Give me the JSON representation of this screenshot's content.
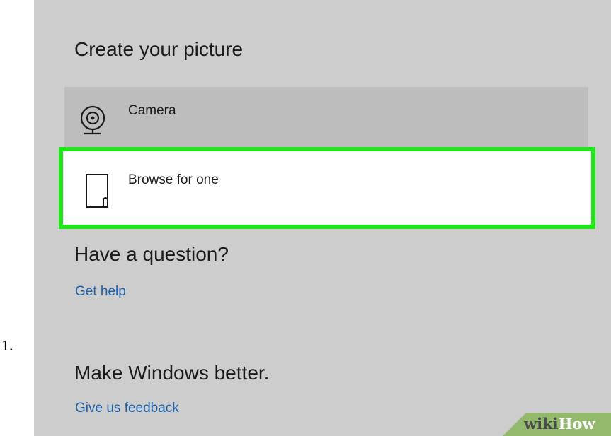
{
  "list_number": "1.",
  "create_section": {
    "title": "Create your picture",
    "options": [
      {
        "label": "Camera",
        "icon": "webcam-icon"
      },
      {
        "label": "Browse for one",
        "icon": "browse-file-icon",
        "highlighted": true,
        "highlight_color": "#22e51b"
      }
    ]
  },
  "question_section": {
    "title": "Have a question?",
    "link": "Get help"
  },
  "feedback_section": {
    "title": "Make Windows better.",
    "link": "Give us feedback"
  },
  "watermark": {
    "wiki": "wiki",
    "how": "How",
    "color": "#93b96d"
  },
  "colors": {
    "panel_background": "#cdcdcd",
    "camera_row_background": "#bdbdbd",
    "link": "#1d5fa8"
  }
}
